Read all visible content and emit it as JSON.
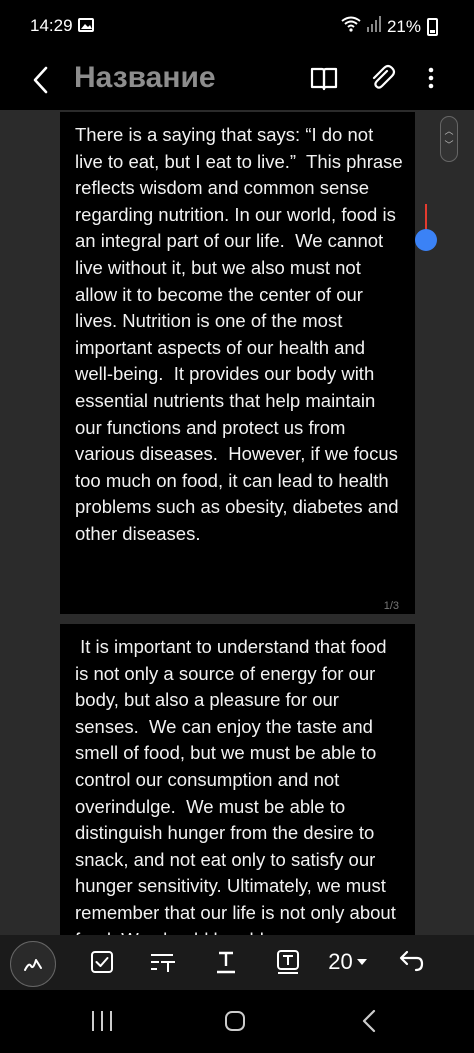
{
  "status": {
    "time": "14:29",
    "battery": "21%"
  },
  "app_bar": {
    "title": "Название"
  },
  "pages": [
    {
      "text": "There is a saying that says: “I do not live to eat, but I eat to live.”  This phrase reflects wisdom and common sense regarding nutrition. In our world, food is an integral part of our life.  We cannot live without it, but we also must not allow it to become the center of our lives. Nutrition is one of the most important aspects of our health and well-being.  It provides our body with essential nutrients that help maintain our functions and protect us from various diseases.  However, if we focus too much on food, it can lead to health problems such as obesity, diabetes and other diseases.",
      "page_label": "1/3"
    },
    {
      "text": " It is important to understand that food is not only a source of energy for our body, but also a pleasure for our senses.  We can enjoy the taste and smell of food, but we must be able to control our consumption and not overindulge.  We must be able to distinguish hunger from the desire to snack, and not eat only to satisfy our hunger sensitivity. Ultimately, we must remember that our life is not only about food. We should be able"
    }
  ],
  "toolbar": {
    "font_size": "20"
  },
  "colors": {
    "canvas_bg": "#2b2b2b",
    "page_bg": "#000000",
    "cursor": "#e53b2f",
    "handle": "#3b82f6"
  }
}
